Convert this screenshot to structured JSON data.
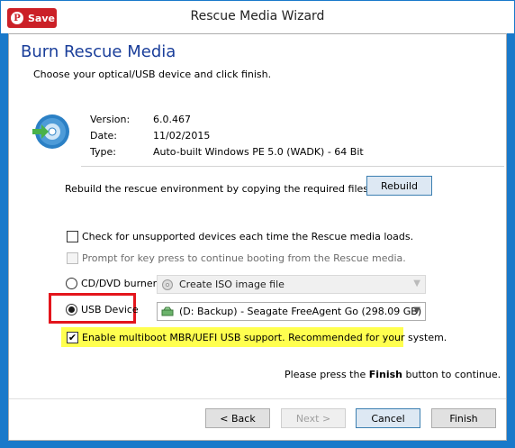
{
  "window": {
    "title": "Rescue Media Wizard"
  },
  "pinterest": {
    "label": "Save",
    "logo": "P"
  },
  "header": {
    "heading": "Burn Rescue Media",
    "subheading": "Choose your optical/USB device and click finish."
  },
  "info": {
    "icon": "disc-with-arrow-icon",
    "version_label": "Version:",
    "version_value": "6.0.467",
    "date_label": "Date:",
    "date_value": "11/02/2015",
    "type_label": "Type:",
    "type_value": "Auto-built Windows PE 5.0 (WADK) - 64 Bit"
  },
  "rebuild": {
    "text": "Rebuild the rescue environment by copying the required files",
    "button": "Rebuild"
  },
  "options": {
    "check_unsupported": {
      "label": "Check for unsupported devices each time the Rescue media loads.",
      "checked": false
    },
    "prompt_key": {
      "label": "Prompt for key press to continue booting from the Rescue media.",
      "checked": false,
      "disabled": true
    }
  },
  "devices": {
    "cd_label": "CD/DVD burner",
    "cd_selected": false,
    "cd_select_value": "Create ISO image file",
    "usb_label": "USB Device",
    "usb_selected": true,
    "usb_select_value": "(D: Backup) - Seagate FreeAgent Go (298.09 GB)",
    "multiboot": {
      "label": "Enable multiboot MBR/UEFI USB support. Recommended for your system.",
      "checked": true
    }
  },
  "note": {
    "prefix": "Please press the",
    "bold": "Finish",
    "suffix": "button to continue."
  },
  "footer": {
    "back": "< Back",
    "next": "Next >",
    "cancel": "Cancel",
    "finish": "Finish"
  },
  "colors": {
    "heading": "#1a3e9a",
    "highlight_box": "#e3151c",
    "highlight_fill": "#ffff4f",
    "pinterest": "#cb2027"
  }
}
